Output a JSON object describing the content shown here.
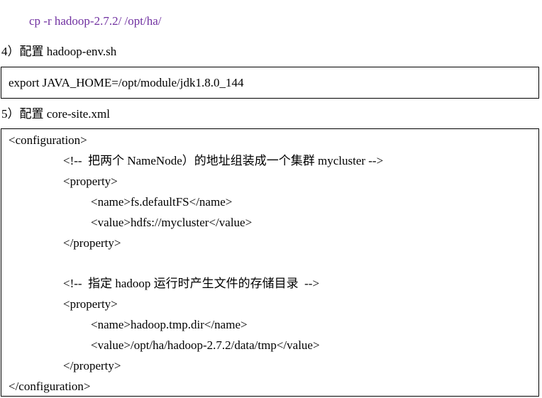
{
  "cp_command": "cp -r hadoop-2.7.2/ /opt/ha/",
  "step4": {
    "heading": "4）配置 hadoop-env.sh",
    "code": "export JAVA_HOME=/opt/module/jdk1.8.0_144"
  },
  "step5": {
    "heading": "5）配置 core-site.xml",
    "lines": [
      "<configuration>",
      "<!--  把两个 NameNode）的地址组装成一个集群 mycluster -->",
      "<property>",
      "<name>fs.defaultFS</name>",
      "<value>hdfs://mycluster</value>",
      "</property>",
      "<!--  指定 hadoop 运行时产生文件的存储目录  -->",
      "<property>",
      "<name>hadoop.tmp.dir</name>",
      "<value>/opt/ha/hadoop-2.7.2/data/tmp</value>",
      "</property>",
      "</configuration>"
    ]
  },
  "colors": {
    "command": "#7030A0",
    "text": "#000000",
    "border": "#000000"
  }
}
